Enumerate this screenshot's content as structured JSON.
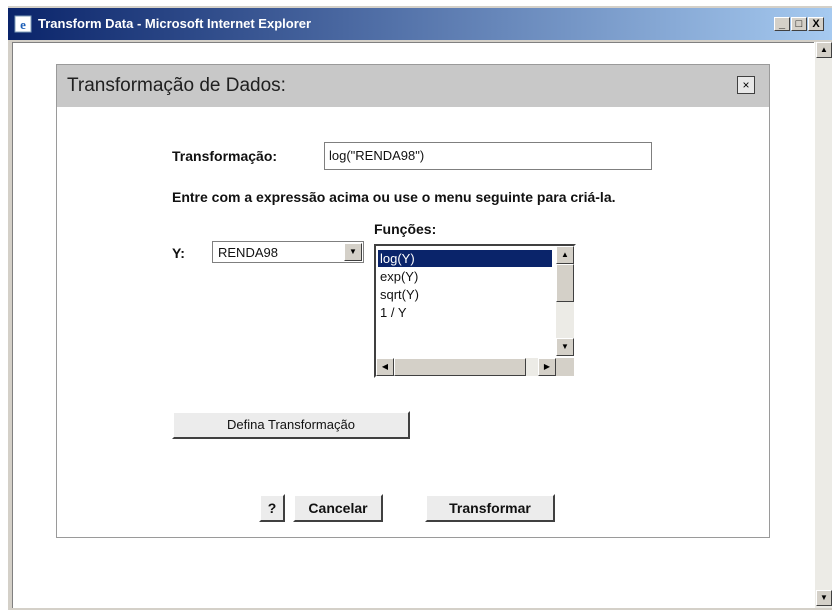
{
  "window": {
    "title": "Transform Data - Microsoft Internet Explorer",
    "minimize_glyph": "_",
    "maximize_glyph": "□",
    "close_glyph": "X",
    "icon": "ie-icon"
  },
  "dialog": {
    "title": "Transformação de Dados:",
    "close_glyph": "×",
    "transformacao_label": "Transformação:",
    "transformacao_value": "log(\"RENDA98\")",
    "instruction": "Entre com a expressão acima ou use o menu seguinte para criá-la.",
    "funcoes_label": "Funções:",
    "y_label": "Y:",
    "y_selected": "RENDA98",
    "funcoes_options": [
      "log(Y)",
      "exp(Y)",
      "sqrt(Y)",
      "1 / Y"
    ],
    "funcoes_selected_index": 0,
    "define_button": "Defina Transformação",
    "help_button": "?",
    "cancel_button": "Cancelar",
    "transform_button": "Transformar"
  },
  "colors": {
    "titlebar_start": "#0a246a",
    "titlebar_end": "#a6caf0",
    "selection": "#0a246a",
    "dialog_header": "#c8c8c8"
  }
}
